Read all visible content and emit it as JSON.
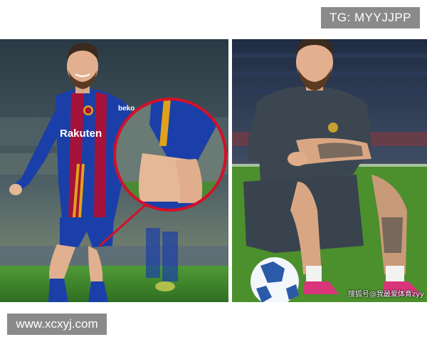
{
  "watermarks": {
    "tg": "TG: MYYJJPP",
    "site": "www.xcxyj.com",
    "sohu": "搜狐号@我最爱体育zyy"
  },
  "left_photo": {
    "sponsor_text": "Rakuten",
    "beko_text": "beko",
    "colors": {
      "blaugrana_blue": "#1b3fa8",
      "blaugrana_red": "#a5123a",
      "gold_stripe": "#e0a21a",
      "highlight_circle": "#d3102a",
      "pitch_green": "#3f8a2c"
    }
  },
  "right_photo": {
    "colors": {
      "kit_dark": "#3b4650",
      "pitch_green": "#4c8f2d",
      "boots_pink": "#d8357a"
    }
  }
}
